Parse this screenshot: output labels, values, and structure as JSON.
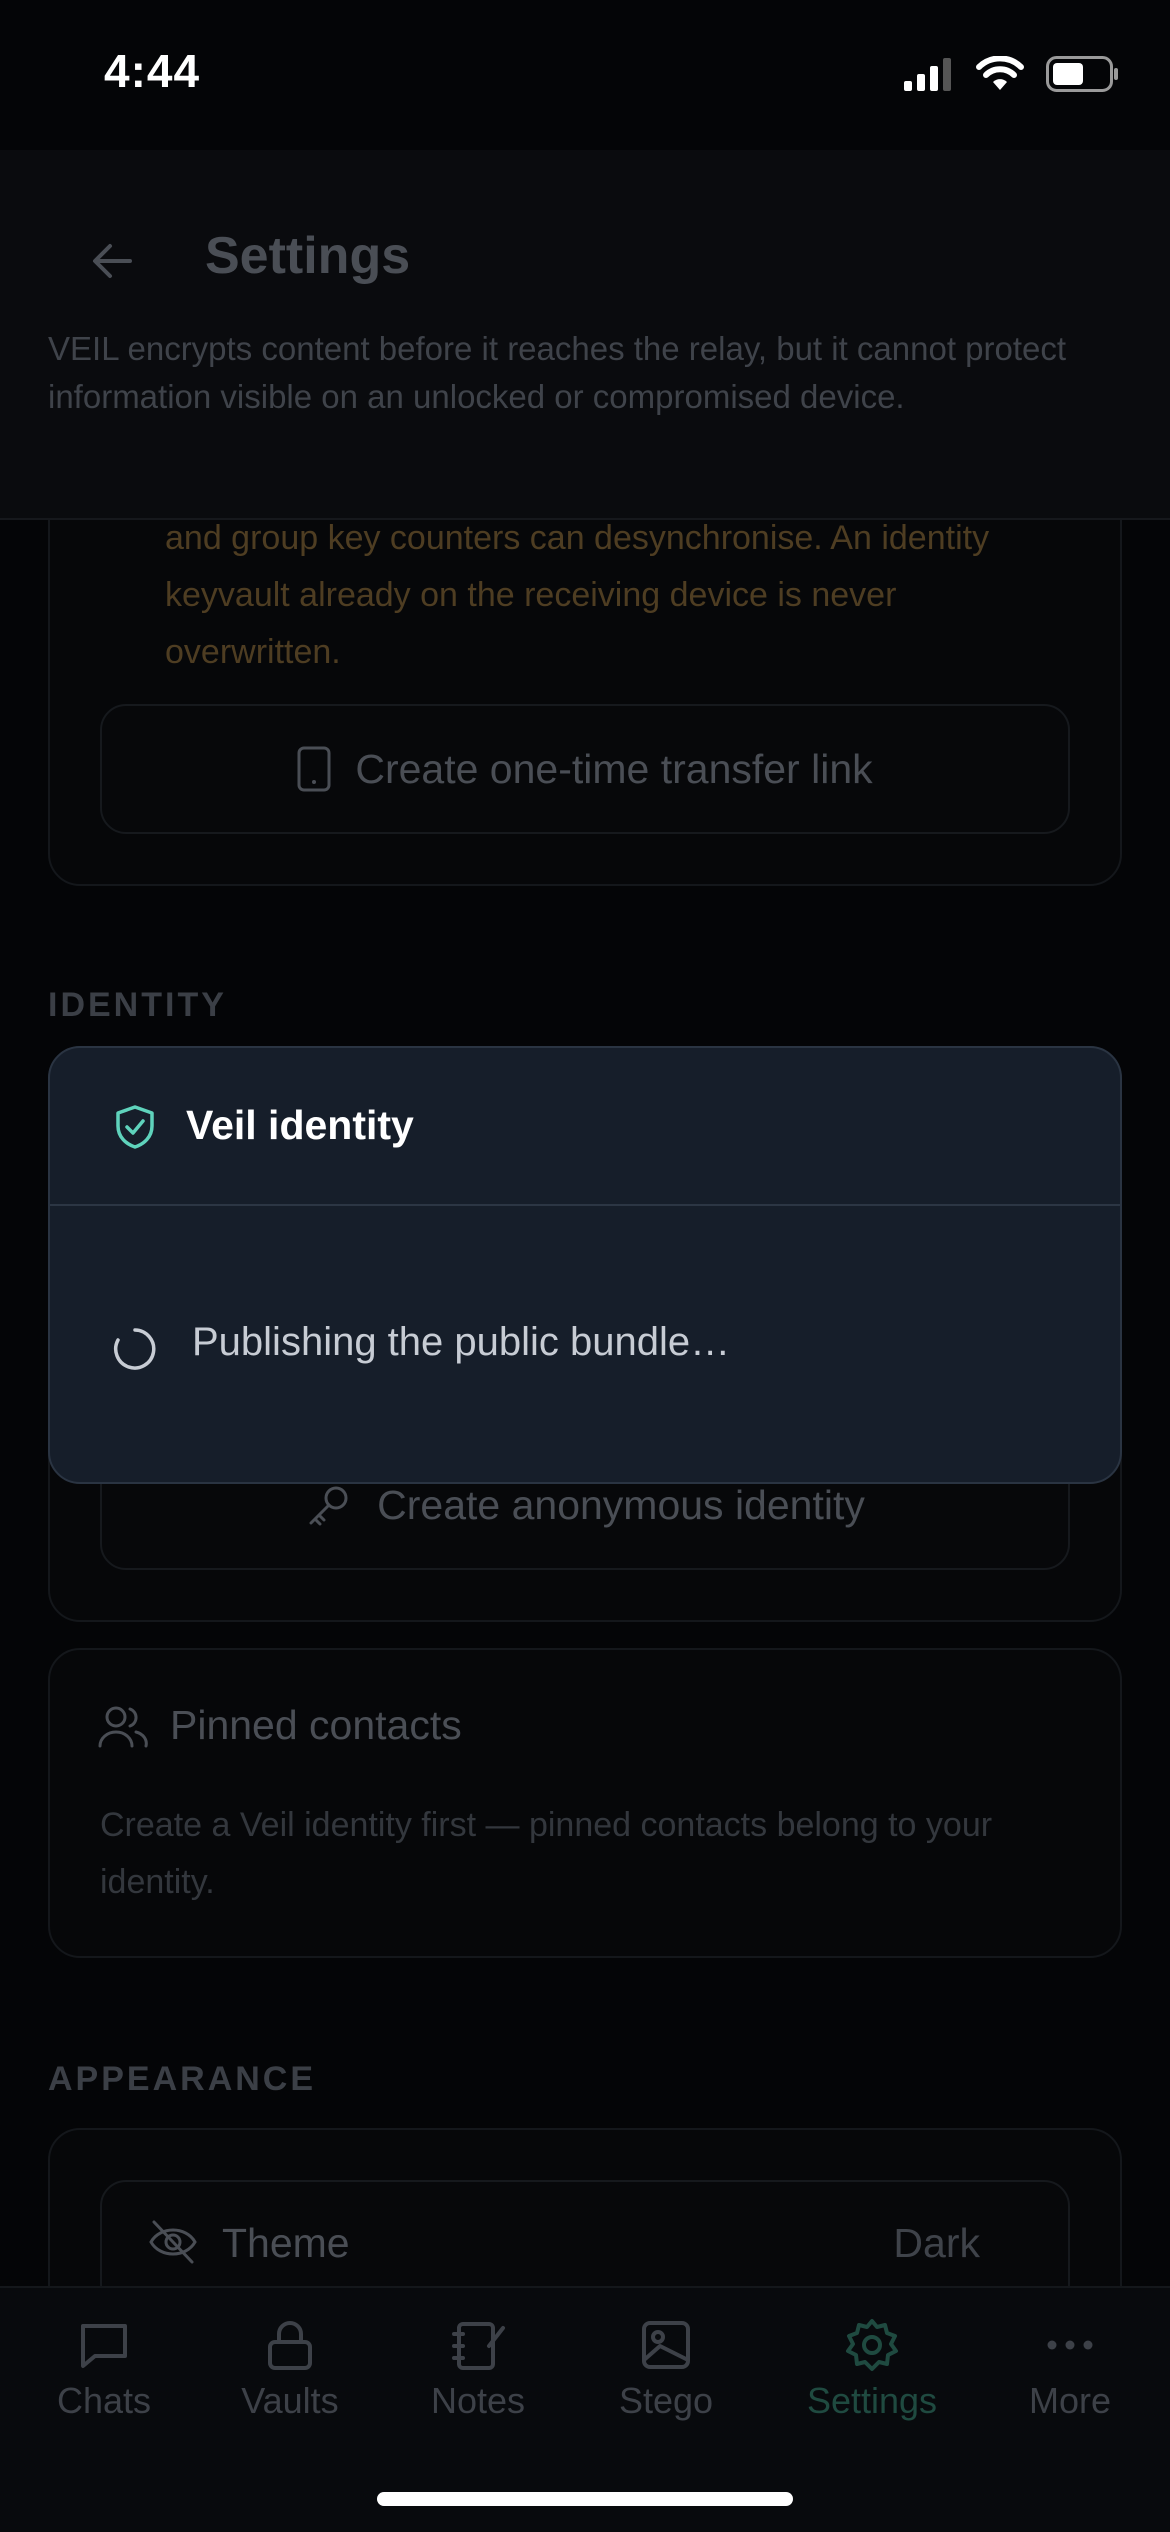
{
  "status_bar": {
    "time": "4:44"
  },
  "header": {
    "title": "Settings",
    "description": "VEIL encrypts content before it reaches the relay, but it cannot protect information visible on an unlocked or compromised device."
  },
  "transfer_card": {
    "warning": "and group key counters can desynchronise. An identity keyvault already on the receiving device is never overwritten.",
    "button_label": "Create one-time transfer link"
  },
  "identity_section": {
    "label": "IDENTITY",
    "anon_button_label": "Create anonymous identity"
  },
  "modal": {
    "title": "Veil identity",
    "message": "Publishing the public bundle…"
  },
  "contacts_card": {
    "title": "Pinned contacts",
    "description": "Create a Veil identity first — pinned contacts belong to your identity."
  },
  "appearance_section": {
    "label": "APPEARANCE",
    "theme_label": "Theme",
    "theme_value": "Dark"
  },
  "tabs": [
    {
      "label": "Chats",
      "icon": "chat-icon"
    },
    {
      "label": "Vaults",
      "icon": "lock-icon"
    },
    {
      "label": "Notes",
      "icon": "notebook-icon"
    },
    {
      "label": "Stego",
      "icon": "image-icon"
    },
    {
      "label": "Settings",
      "icon": "gear-icon",
      "active": true
    },
    {
      "label": "More",
      "icon": "more-icon"
    }
  ],
  "colors": {
    "accent": "#5fd3bc",
    "modal_bg": "#161e2a",
    "warning": "#4e3d22"
  }
}
